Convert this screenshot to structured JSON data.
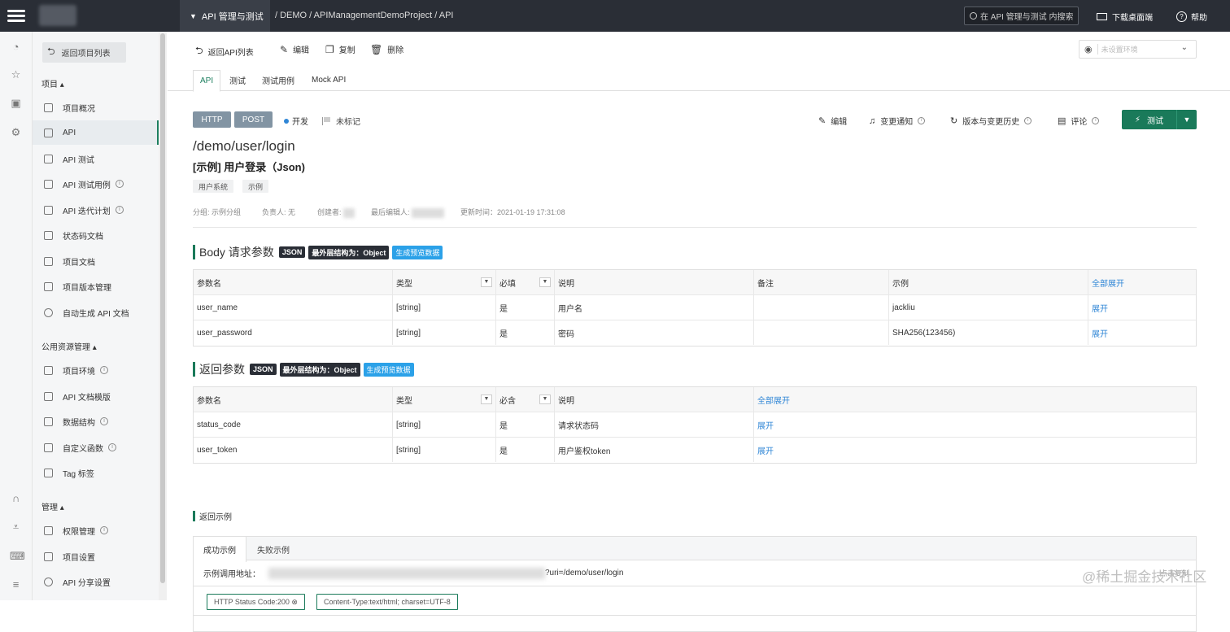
{
  "topbar": {
    "module": "API 管理与测试",
    "breadcrumb": "/ DEMO / APIManagementDemoProject / API",
    "search_placeholder": "在 API 管理与测试 内搜索",
    "download": "下载桌面端",
    "help": "帮助"
  },
  "sidebar": {
    "back": "返回项目列表",
    "section_project": "项目 ▴",
    "project_items": [
      {
        "label": "项目概况"
      },
      {
        "label": "API"
      },
      {
        "label": "API 测试"
      },
      {
        "label": "API 测试用例"
      },
      {
        "label": "API 迭代计划"
      },
      {
        "label": "状态码文档"
      },
      {
        "label": "项目文档"
      },
      {
        "label": "项目版本管理"
      },
      {
        "label": "自动生成 API 文档"
      }
    ],
    "section_public": "公用资源管理 ▴",
    "public_items": [
      {
        "label": "项目环境"
      },
      {
        "label": "API 文档模版"
      },
      {
        "label": "数据结构"
      },
      {
        "label": "自定义函数"
      },
      {
        "label": "Tag 标签"
      }
    ],
    "section_manage": "管理 ▴",
    "manage_items": [
      {
        "label": "权限管理"
      },
      {
        "label": "项目设置"
      },
      {
        "label": "API 分享设置"
      }
    ]
  },
  "toolbar": {
    "back": "返回API列表",
    "edit": "编辑",
    "copy": "复制",
    "delete": "删除",
    "env_placeholder": "未设置环境"
  },
  "tabs": [
    "API",
    "测试",
    "测试用例",
    "Mock API"
  ],
  "api": {
    "protocol": "HTTP",
    "method": "POST",
    "status": "开发",
    "flag": "未标记",
    "path": "/demo/user/login",
    "name": "[示例] 用户登录（Json)",
    "tags": [
      "用户系统",
      "示例"
    ],
    "meta": {
      "group": "分组: 示例分组",
      "owner": "负责人: 无",
      "creator": "创建者:",
      "last_editor": "最后编辑人:",
      "updated": "更新时间：2021-01-19 17:31:08"
    }
  },
  "actions": {
    "edit": "编辑",
    "notify": "变更通知",
    "history": "版本与变更历史",
    "comment": "评论",
    "test": "测试"
  },
  "body_params": {
    "title": "Body 请求参数",
    "badge_json": "JSON",
    "badge_outer": "最外层结构为：Object",
    "badge_gen": "生成预览数据",
    "headers": [
      "参数名",
      "类型",
      "必填",
      "说明",
      "备注",
      "示例",
      "全部展开"
    ],
    "rows": [
      {
        "name": "user_name",
        "type": "[string]",
        "required": "是",
        "desc": "用户名",
        "note": "",
        "example": "jackliu",
        "expand": "展开"
      },
      {
        "name": "user_password",
        "type": "[string]",
        "required": "是",
        "desc": "密码",
        "note": "",
        "example": "SHA256(123456)",
        "expand": "展开"
      }
    ]
  },
  "return_params": {
    "title": "返回参数",
    "badge_json": "JSON",
    "badge_outer": "最外层结构为：Object",
    "badge_gen": "生成预览数据",
    "headers": [
      "参数名",
      "类型",
      "必含",
      "说明",
      "全部展开"
    ],
    "rows": [
      {
        "name": "status_code",
        "type": "[string]",
        "required": "是",
        "desc": "请求状态码",
        "expand": "展开"
      },
      {
        "name": "user_token",
        "type": "[string]",
        "required": "是",
        "desc": "用户鉴权token",
        "expand": "展开"
      }
    ]
  },
  "example": {
    "title": "返回示例",
    "tab_success": "成功示例",
    "tab_fail": "失败示例",
    "url_label": "示例调用地址：",
    "url_suffix": "?uri=/demo/user/login",
    "copy": "点击复制",
    "status_badge": "HTTP Status Code:200 ⊗",
    "content_badge": "Content-Type:text/html; charset=UTF-8"
  },
  "watermark": "@稀土掘金技术社区"
}
